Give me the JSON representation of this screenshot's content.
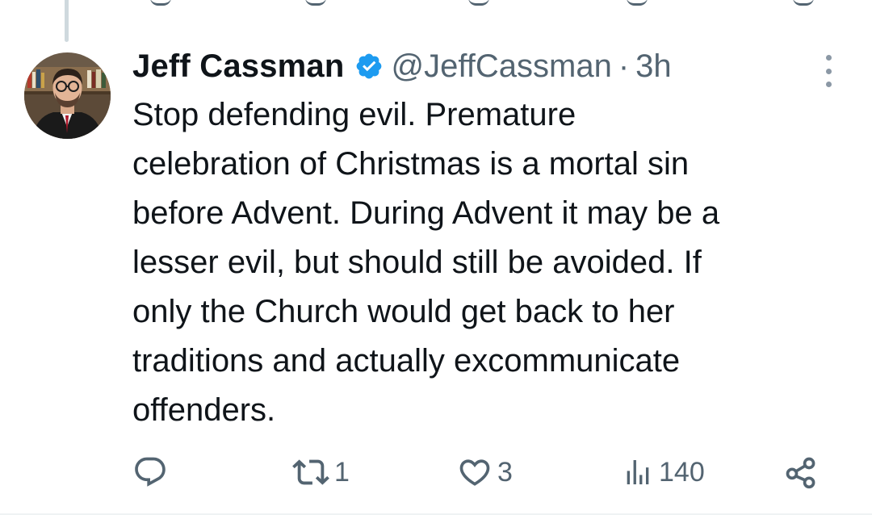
{
  "tweet": {
    "author": {
      "display_name": "Jeff Cassman",
      "handle": "@JeffCassman",
      "verified": true,
      "verified_color": "#1d9bf0"
    },
    "separator": "·",
    "time": "3h",
    "text_lines": [
      "Stop defending evil. Premature",
      "celebration of Christmas is a mortal sin",
      "before Advent. During Advent it may be a",
      "lesser evil, but should still be avoided. If",
      "only the Church would get back to her",
      "traditions and actually excommunicate",
      "offenders."
    ],
    "actions": {
      "reply_icon": "reply-icon",
      "retweet_icon": "retweet-icon",
      "retweet_count": "1",
      "like_icon": "heart-icon",
      "like_count": "3",
      "views_icon": "views-icon",
      "views_count": "140",
      "share_icon": "share-icon"
    }
  },
  "colors": {
    "text_primary": "#0f1419",
    "text_secondary": "#536471",
    "accent": "#1d9bf0",
    "thread_line": "#cfd9de"
  }
}
